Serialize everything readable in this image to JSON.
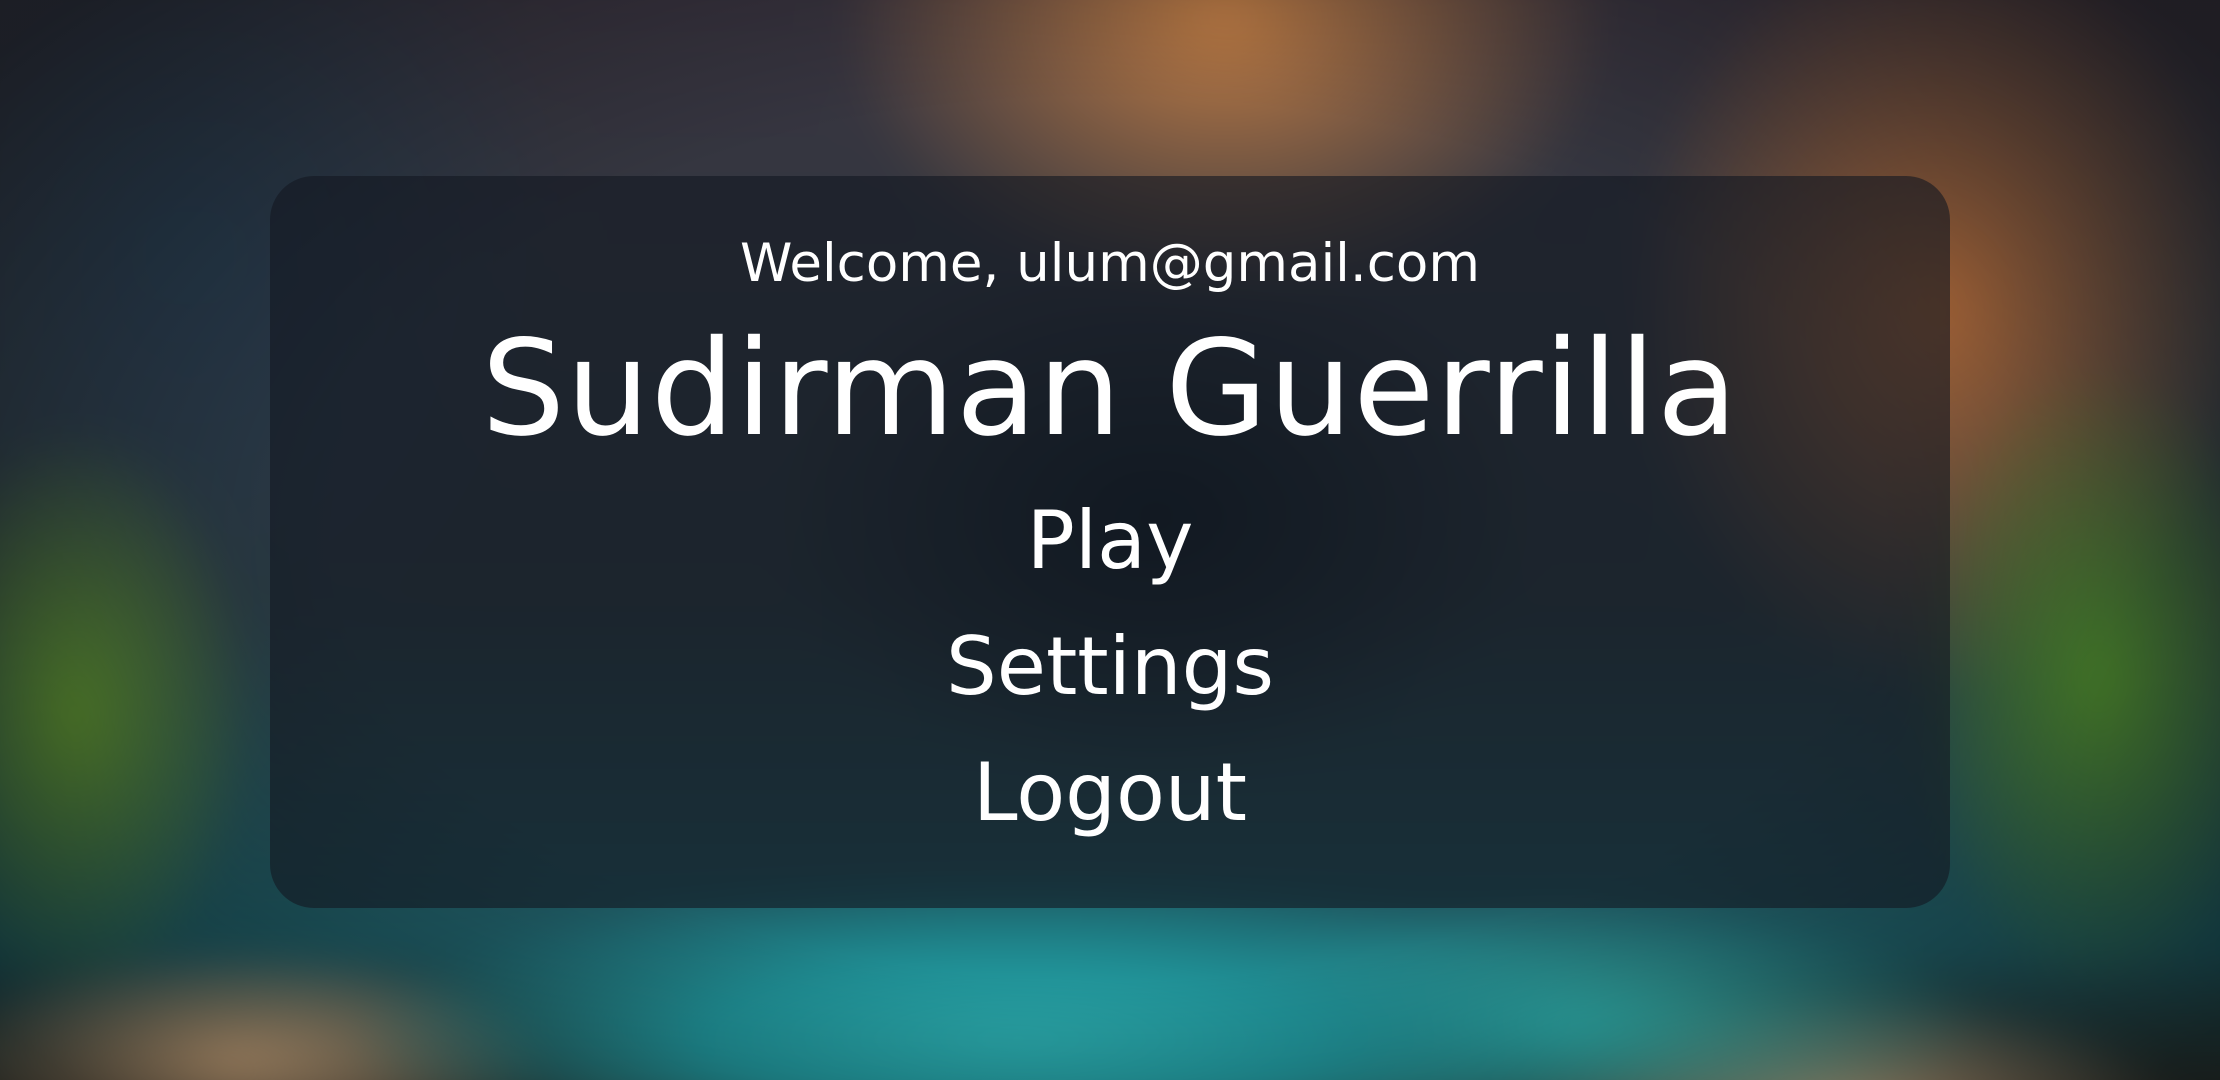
{
  "menu_screen": {
    "welcome_text": "Welcome, ulum@gmail.com",
    "game_title": "Sudirman Guerrilla",
    "buttons": {
      "play": "Play",
      "settings": "Settings",
      "logout": "Logout"
    }
  },
  "colors": {
    "text": "#ffffff",
    "panel_overlay": "#141822"
  }
}
